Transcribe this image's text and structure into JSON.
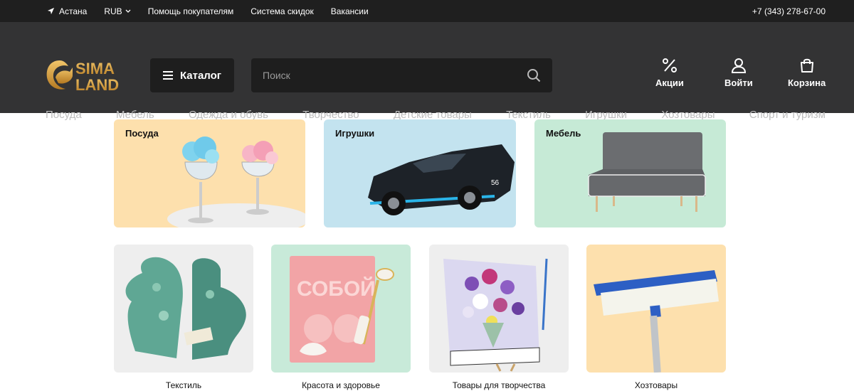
{
  "topbar": {
    "city": "Астана",
    "currency": "RUB",
    "links": [
      "Помощь покупателям",
      "Система скидок",
      "Вакансии"
    ],
    "phone": "+7 (343) 278-67-00"
  },
  "header": {
    "logo_line1": "SIMA",
    "logo_line2": "LAND",
    "catalog_label": "Каталог",
    "search_placeholder": "Поиск",
    "actions": {
      "promo": "Акции",
      "login": "Войти",
      "cart": "Корзина"
    }
  },
  "nav": [
    "Посуда",
    "Мебель",
    "Одежда и обувь",
    "Творчество",
    "Детские товары",
    "Текстиль",
    "Игрушки",
    "Хозтовары",
    "Спорт и туризм"
  ],
  "banners": [
    {
      "title": "Посуда",
      "bg": "#fde0ad"
    },
    {
      "title": "Игрушки",
      "bg": "#c3e3ef"
    },
    {
      "title": "Мебель",
      "bg": "#c6ead6"
    }
  ],
  "tiles": [
    {
      "caption": "Текстиль",
      "bg": "#eeeeee"
    },
    {
      "caption": "Красота и здоровье",
      "bg": "#c8ead9"
    },
    {
      "caption": "Товары для творчества",
      "bg": "#eeeeee"
    },
    {
      "caption": "Хозтовары",
      "bg": "#fde0ad"
    }
  ],
  "colors": {
    "brand_gold": "#d9a441",
    "header_bg": "#333334",
    "topbar_bg": "#1f1f1f"
  }
}
